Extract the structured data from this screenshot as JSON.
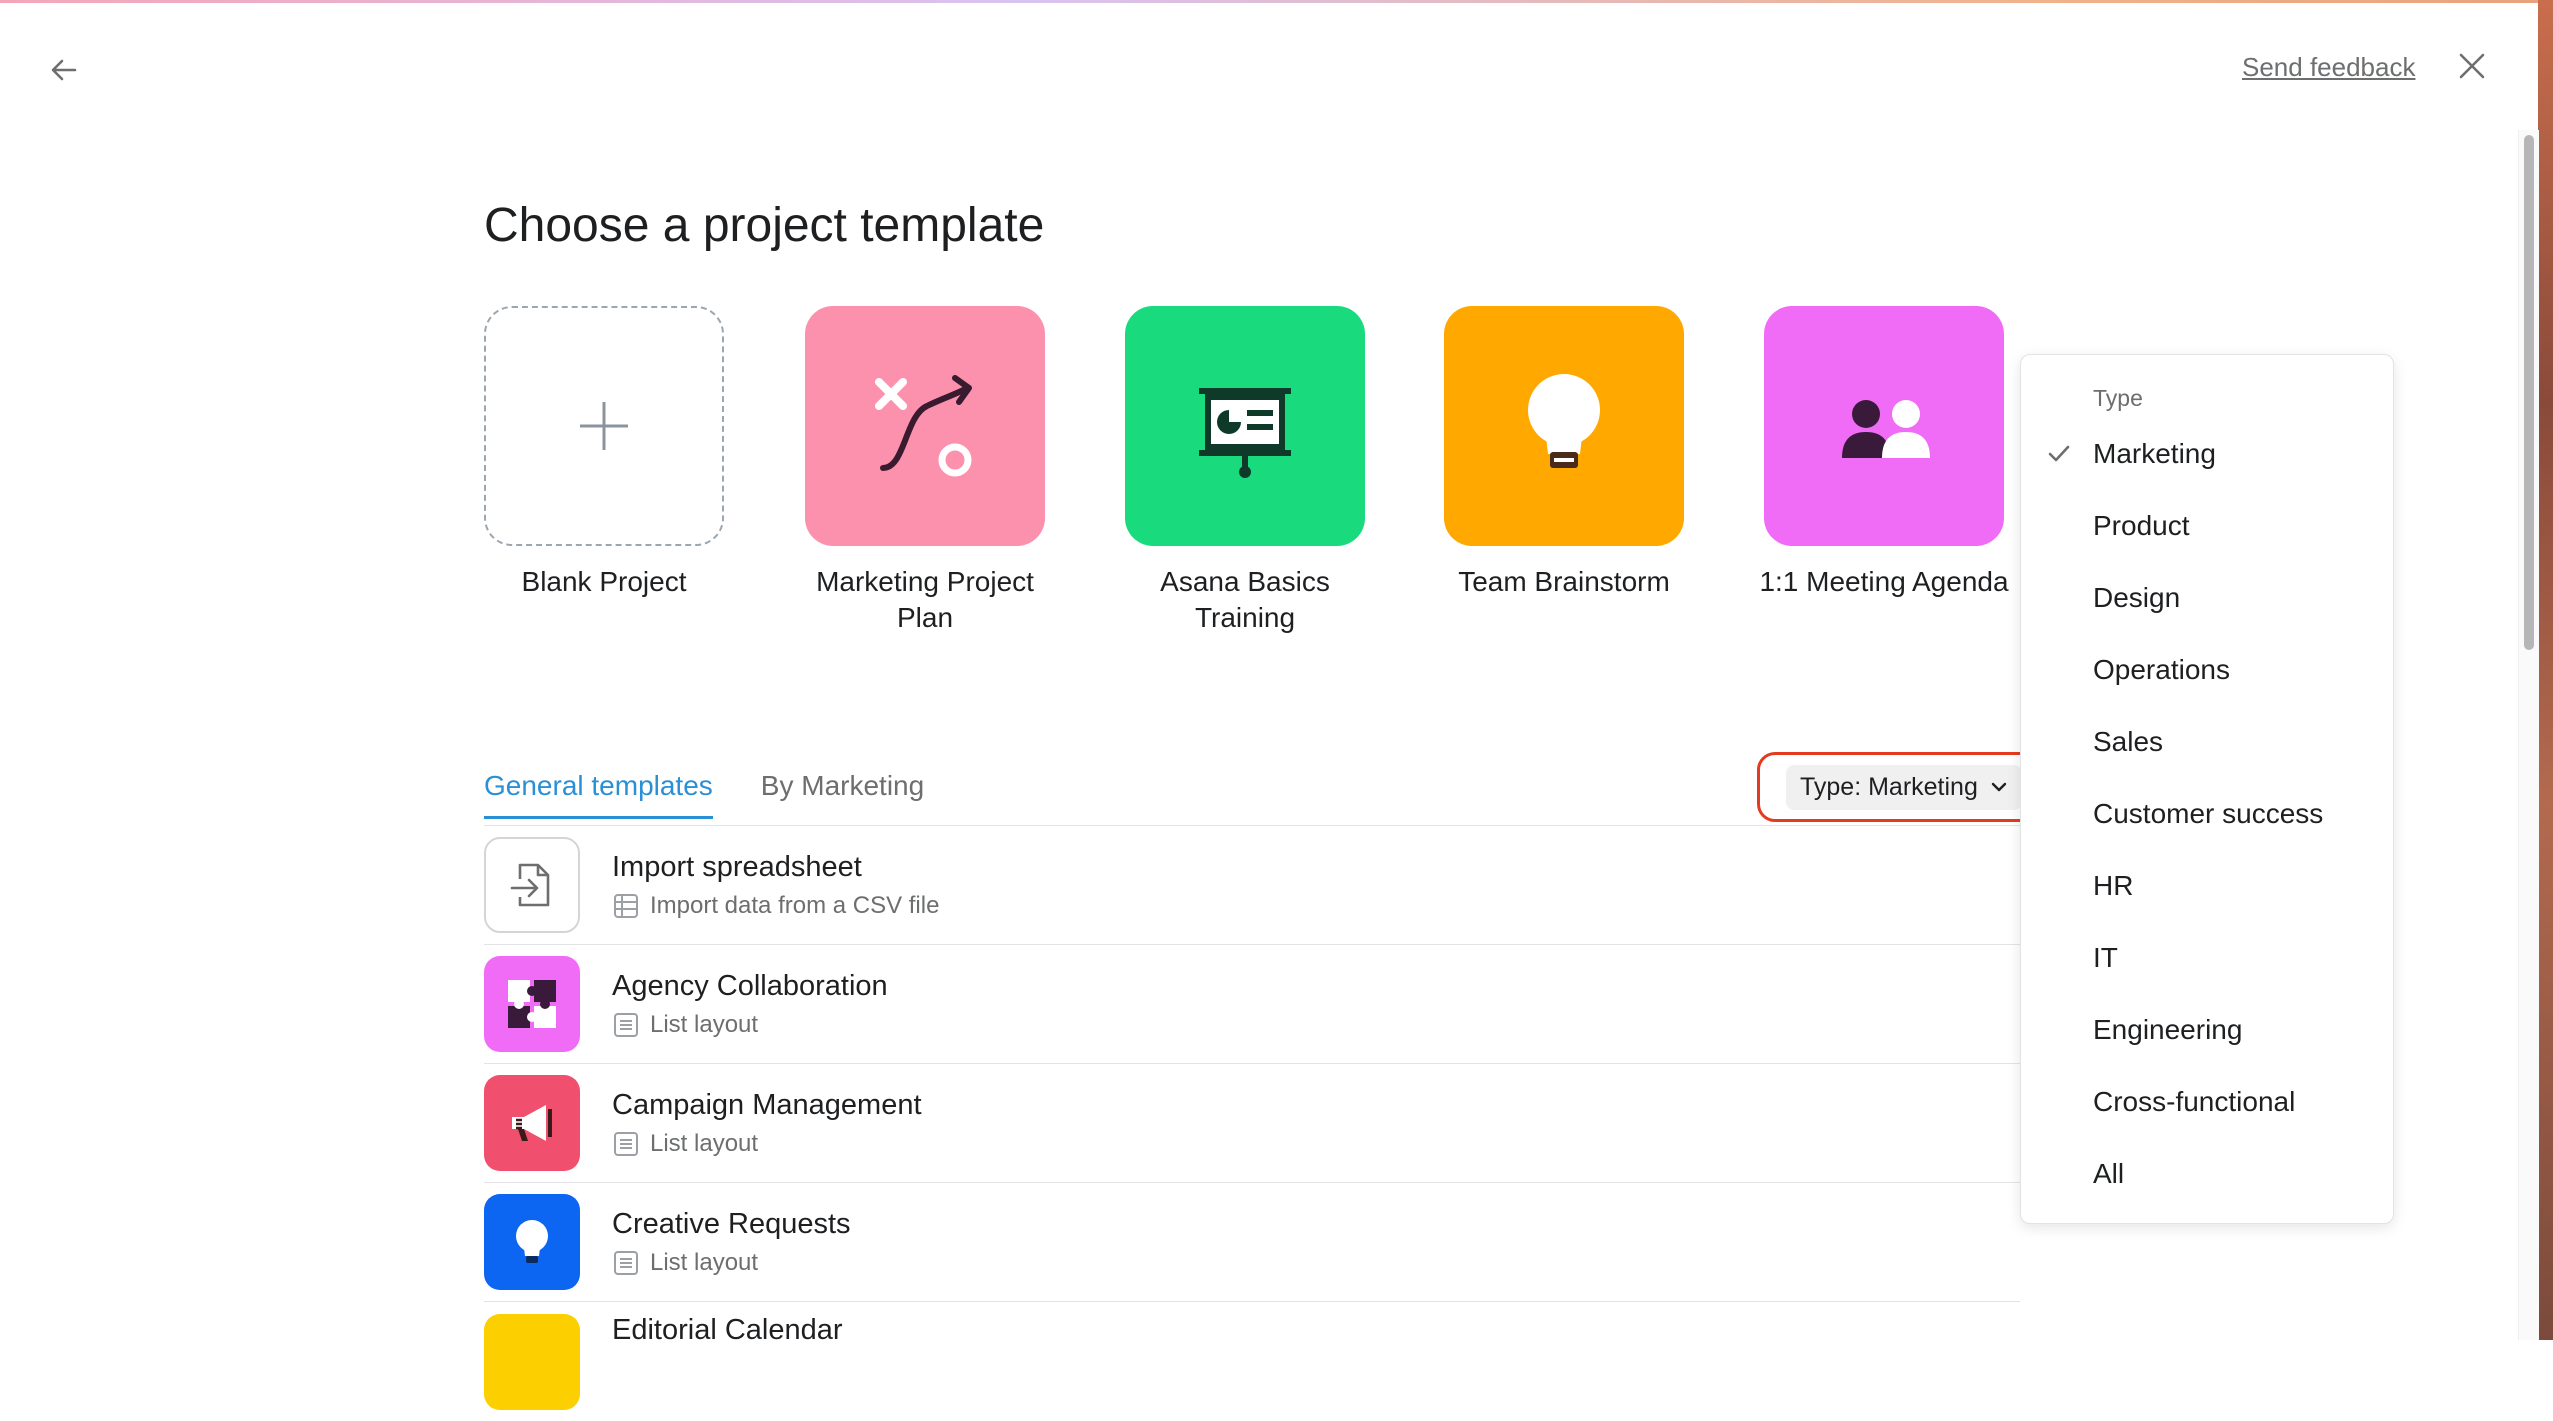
{
  "header": {
    "send_feedback": "Send feedback"
  },
  "page": {
    "title": "Choose a project template"
  },
  "featured_templates": [
    {
      "label": "Blank Project",
      "icon": "plus-icon"
    },
    {
      "label": "Marketing Project Plan",
      "icon": "strategy-icon",
      "color": "#fc91ad"
    },
    {
      "label": "Asana Basics Training",
      "icon": "presentation-icon",
      "color": "#19db7e"
    },
    {
      "label": "Team Brainstorm",
      "icon": "lightbulb-icon",
      "color": "#ffa800"
    },
    {
      "label": "1:1 Meeting Agenda",
      "icon": "people-icon",
      "color": "#f06cf6"
    }
  ],
  "tabs": [
    {
      "label": "General templates",
      "active": true
    },
    {
      "label": "By Marketing",
      "active": false
    }
  ],
  "filter": {
    "label": "Type: Marketing"
  },
  "templates": [
    {
      "title": "Import spreadsheet",
      "subtitle": "Import data from a CSV file",
      "icon": "import-file-icon",
      "sub_icon": "table-icon"
    },
    {
      "title": "Agency Collaboration",
      "subtitle": "List layout",
      "icon": "puzzle-icon",
      "sub_icon": "list-icon",
      "color": "#f06cf6"
    },
    {
      "title": "Campaign Management",
      "subtitle": "List layout",
      "icon": "megaphone-icon",
      "sub_icon": "list-icon",
      "color": "#f0506e"
    },
    {
      "title": "Creative Requests",
      "subtitle": "List layout",
      "icon": "lightbulb-icon",
      "sub_icon": "list-icon",
      "color": "#0d66f2"
    },
    {
      "title": "Editorial Calendar",
      "subtitle": "",
      "icon": "calendar-icon",
      "color": "#fcd000"
    }
  ],
  "dropdown": {
    "header": "Type",
    "options": [
      {
        "label": "Marketing",
        "selected": true
      },
      {
        "label": "Product",
        "selected": false
      },
      {
        "label": "Design",
        "selected": false
      },
      {
        "label": "Operations",
        "selected": false
      },
      {
        "label": "Sales",
        "selected": false
      },
      {
        "label": "Customer success",
        "selected": false
      },
      {
        "label": "HR",
        "selected": false
      },
      {
        "label": "IT",
        "selected": false
      },
      {
        "label": "Engineering",
        "selected": false
      },
      {
        "label": "Cross-functional",
        "selected": false
      },
      {
        "label": "All",
        "selected": false
      }
    ]
  }
}
